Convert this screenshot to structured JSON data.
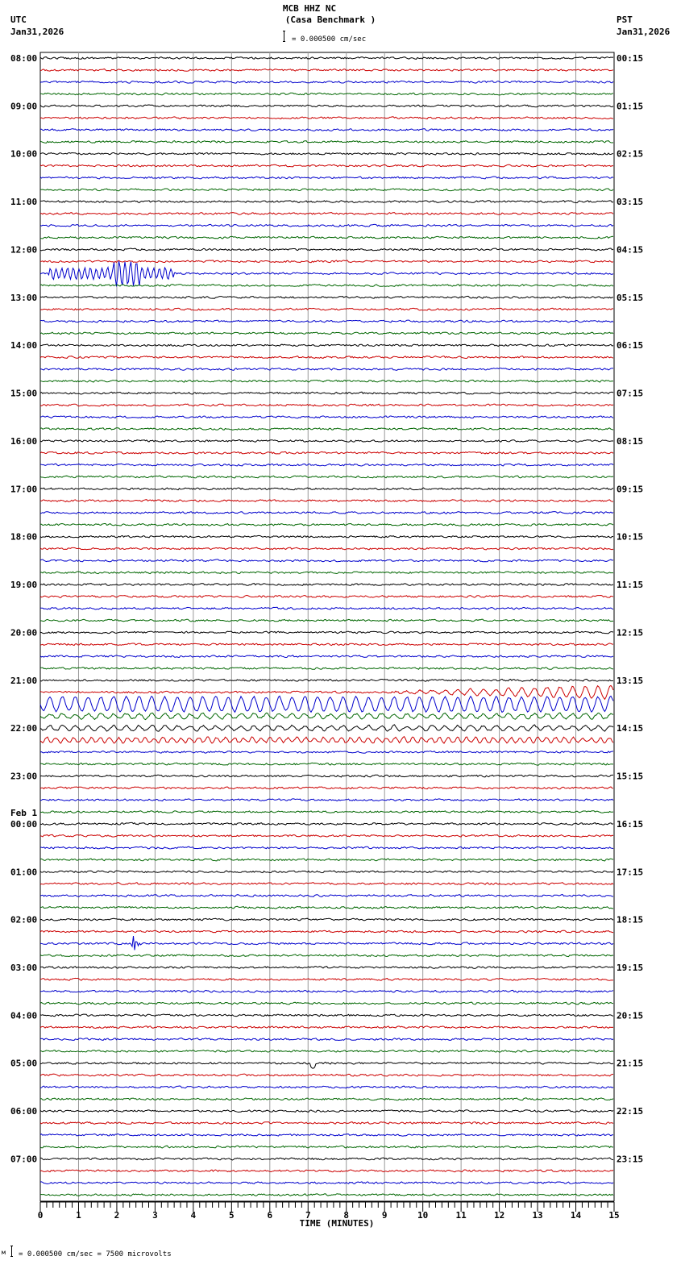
{
  "header": {
    "station": "MCB HHZ NC",
    "site": "(Casa Benchmark )",
    "left_tz": "UTC",
    "left_date": "Jan31,2026",
    "right_tz": "PST",
    "right_date": "Jan31,2026",
    "scale": "= 0.000500 cm/sec"
  },
  "footer": {
    "scale_prefix": "м",
    "scale": "= 0.000500 cm/sec =    7500 microvolts"
  },
  "chart_data": {
    "type": "line",
    "title": "MCB HHZ NC (Casa Benchmark )",
    "xlabel": "TIME (MINUTES)",
    "xlim": [
      0,
      15
    ],
    "x_ticks": [
      "0",
      "1",
      "2",
      "3",
      "4",
      "5",
      "6",
      "7",
      "8",
      "9",
      "10",
      "11",
      "12",
      "13",
      "14",
      "15"
    ],
    "grid": true,
    "trace_count": 96,
    "trace_colors": [
      "#000000",
      "#cc0000",
      "#0000cc",
      "#006600"
    ],
    "left_labels": [
      "08:00",
      "09:00",
      "10:00",
      "11:00",
      "12:00",
      "13:00",
      "14:00",
      "15:00",
      "16:00",
      "17:00",
      "18:00",
      "19:00",
      "20:00",
      "21:00",
      "22:00",
      "23:00",
      "00:00",
      "01:00",
      "02:00",
      "03:00",
      "04:00",
      "05:00",
      "06:00",
      "07:00"
    ],
    "date_change": {
      "hour_index": 16,
      "label": "Feb 1"
    },
    "right_labels": [
      "00:15",
      "01:15",
      "02:15",
      "03:15",
      "04:15",
      "05:15",
      "06:15",
      "07:15",
      "08:15",
      "09:15",
      "10:15",
      "11:15",
      "12:15",
      "13:15",
      "14:15",
      "15:15",
      "16:15",
      "17:15",
      "18:15",
      "19:15",
      "20:15",
      "21:15",
      "22:15",
      "23:15"
    ],
    "events": [
      {
        "trace": 18,
        "start_min": 0.2,
        "end_min": 3.5,
        "amp": 0.45,
        "period_sec": 9
      },
      {
        "trace": 18,
        "start_min": 1.9,
        "end_min": 2.6,
        "amp": 0.6,
        "period_sec": 9
      },
      {
        "trace": 53,
        "start_min": 8.5,
        "end_min": 15,
        "amp": 0.55,
        "period_sec": 20,
        "grow": true
      },
      {
        "trace": 54,
        "start_min": 0,
        "end_min": 15,
        "amp": 0.6,
        "period_sec": 20
      },
      {
        "trace": 55,
        "start_min": 0,
        "end_min": 15,
        "amp": 0.2,
        "period_sec": 20
      },
      {
        "trace": 56,
        "start_min": 0,
        "end_min": 15,
        "amp": 0.2,
        "period_sec": 20
      },
      {
        "trace": 57,
        "start_min": 0,
        "end_min": 15,
        "amp": 0.2,
        "period_sec": 14
      },
      {
        "trace": 74,
        "start_min": 2.4,
        "end_min": 2.7,
        "amp": 1.2,
        "period_sec": 3,
        "spike": true
      },
      {
        "trace": 84,
        "start_min": 7.05,
        "end_min": 7.2,
        "amp": 0.4,
        "period_sec": 2
      }
    ]
  }
}
